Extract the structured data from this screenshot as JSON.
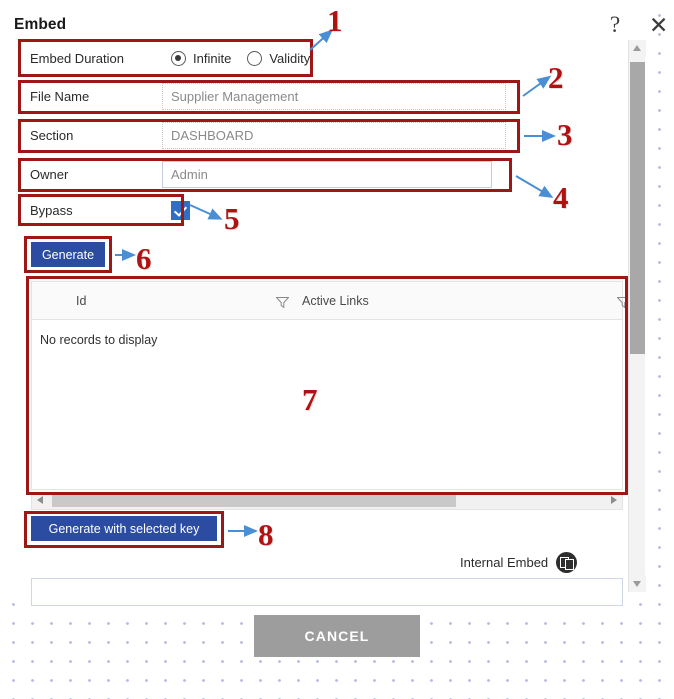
{
  "dialog": {
    "title": "Embed",
    "help_icon": "question-mark-icon",
    "close_icon": "close-x-icon"
  },
  "form": {
    "duration": {
      "label": "Embed Duration",
      "options": [
        {
          "label": "Infinite",
          "selected": true
        },
        {
          "label": "Validity",
          "selected": false
        }
      ]
    },
    "file_name": {
      "label": "File Name",
      "value": "Supplier Management"
    },
    "section": {
      "label": "Section",
      "value": "DASHBOARD"
    },
    "owner": {
      "label": "Owner",
      "value": "Admin"
    },
    "bypass": {
      "label": "Bypass",
      "checked": true
    }
  },
  "buttons": {
    "generate": "Generate",
    "generate_with_selected_key": "Generate with selected key",
    "cancel": "CANCEL"
  },
  "grid": {
    "columns": [
      "Id",
      "Active Links"
    ],
    "rows": [],
    "empty_message": "No records to display",
    "filter_icon": "funnel-filter-icon"
  },
  "embed": {
    "label": "Internal Embed",
    "copy_icon": "copy-icon",
    "url": ""
  },
  "scrollbars": {
    "vertical": "vertical-scrollbar",
    "horizontal": "horizontal-scrollbar"
  },
  "annotations": {
    "numbers": [
      "1",
      "2",
      "3",
      "4",
      "5",
      "6",
      "7",
      "8"
    ],
    "color": "#b01212",
    "box_color": "#9e1616",
    "arrow_color": "#4a8fd4"
  },
  "colors": {
    "primary_button": "#2b4ca0",
    "cancel_button": "#9d9d9d",
    "checkbox": "#2f6fc4",
    "backdrop_dot": "#b9c0e8"
  }
}
